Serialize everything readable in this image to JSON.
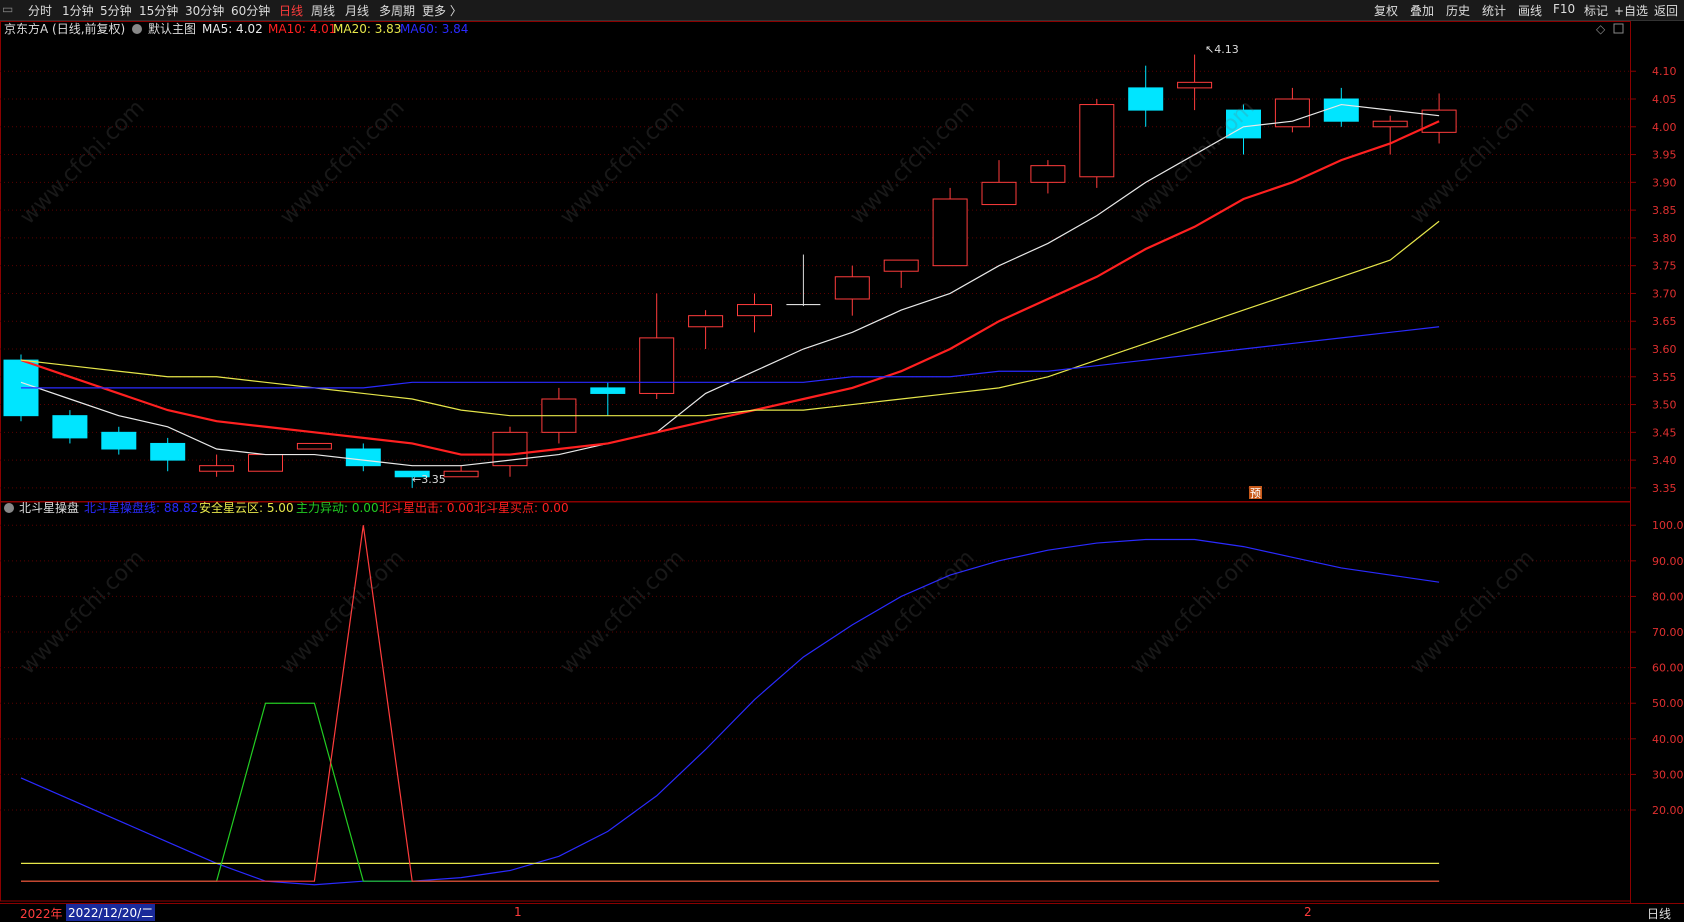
{
  "toolbar": {
    "left_items": [
      "分时",
      "1分钟",
      "5分钟",
      "15分钟",
      "30分钟",
      "60分钟",
      "日线",
      "周线",
      "月线",
      "多周期",
      "更多 〉"
    ],
    "active": "日线",
    "right_items": [
      "复权",
      "叠加",
      "历史",
      "统计",
      "画线",
      "F10",
      "标记",
      "+自选",
      "返回"
    ]
  },
  "main_header": {
    "stock": "京东方A (日线,前复权)",
    "template": "默认主图",
    "ma5": "MA5: 4.02",
    "ma10": "MA10: 4.01",
    "ma20": "MA20: 3.83",
    "ma60": "MA60: 3.84"
  },
  "indicator_header": {
    "name": "北斗星操盘",
    "line1": "北斗星操盘线: 88.82",
    "line2": "安全星云区: 5.00",
    "line3": "主力异动: 0.00",
    "line4": "北斗星出击: 0.00",
    "line5": "北斗星买点: 0.00"
  },
  "annotations": {
    "high": "4.13",
    "low": "3.35",
    "pre": "预"
  },
  "watermark": "www.cfchi.com",
  "bottom": {
    "year": "2022年",
    "cursor_date": "2022/12/20/二",
    "m1": "1",
    "m2": "2",
    "period": "日线"
  },
  "colors": {
    "up": "#ff3c3c",
    "down": "#00e5ff",
    "ma5": "#e8e8e8",
    "ma10": "#ff2020",
    "ma20": "#e6e64a",
    "ma60": "#2a2aff",
    "ind_green": "#22cc22",
    "ind_blue": "#2a2aff",
    "ind_yellow": "#e6e64a"
  },
  "chart_data": [
    {
      "type": "candlestick",
      "title": "京东方A (日线,前复权)",
      "ylim": [
        3.33,
        4.14
      ],
      "yticks": [
        "4.10",
        "4.05",
        "4.00",
        "3.95",
        "3.90",
        "3.85",
        "3.80",
        "3.75",
        "3.70",
        "3.65",
        "3.60",
        "3.55",
        "3.50",
        "3.45",
        "3.40",
        "3.35"
      ],
      "candles": [
        {
          "o": 3.58,
          "c": 3.48,
          "h": 3.59,
          "l": 3.47
        },
        {
          "o": 3.48,
          "c": 3.44,
          "h": 3.49,
          "l": 3.43
        },
        {
          "o": 3.45,
          "c": 3.42,
          "h": 3.46,
          "l": 3.41
        },
        {
          "o": 3.43,
          "c": 3.4,
          "h": 3.44,
          "l": 3.38
        },
        {
          "o": 3.38,
          "c": 3.39,
          "h": 3.41,
          "l": 3.37
        },
        {
          "o": 3.38,
          "c": 3.41,
          "h": 3.41,
          "l": 3.38
        },
        {
          "o": 3.42,
          "c": 3.43,
          "h": 3.43,
          "l": 3.42
        },
        {
          "o": 3.42,
          "c": 3.39,
          "h": 3.43,
          "l": 3.38
        },
        {
          "o": 3.38,
          "c": 3.37,
          "h": 3.38,
          "l": 3.35
        },
        {
          "o": 3.37,
          "c": 3.38,
          "h": 3.39,
          "l": 3.37
        },
        {
          "o": 3.39,
          "c": 3.45,
          "h": 3.46,
          "l": 3.37
        },
        {
          "o": 3.45,
          "c": 3.51,
          "h": 3.53,
          "l": 3.43
        },
        {
          "o": 3.53,
          "c": 3.52,
          "h": 3.54,
          "l": 3.48
        },
        {
          "o": 3.52,
          "c": 3.62,
          "h": 3.7,
          "l": 3.51
        },
        {
          "o": 3.64,
          "c": 3.66,
          "h": 3.67,
          "l": 3.6
        },
        {
          "o": 3.66,
          "c": 3.68,
          "h": 3.7,
          "l": 3.63
        },
        {
          "o": 3.68,
          "c": 3.68,
          "h": 3.77,
          "l": 3.68
        },
        {
          "o": 3.69,
          "c": 3.73,
          "h": 3.75,
          "l": 3.66
        },
        {
          "o": 3.74,
          "c": 3.76,
          "h": 3.76,
          "l": 3.71
        },
        {
          "o": 3.75,
          "c": 3.87,
          "h": 3.89,
          "l": 3.75
        },
        {
          "o": 3.86,
          "c": 3.9,
          "h": 3.94,
          "l": 3.86
        },
        {
          "o": 3.9,
          "c": 3.93,
          "h": 3.94,
          "l": 3.88
        },
        {
          "o": 3.91,
          "c": 4.04,
          "h": 4.05,
          "l": 3.89
        },
        {
          "o": 4.07,
          "c": 4.03,
          "h": 4.11,
          "l": 4.0
        },
        {
          "o": 4.07,
          "c": 4.08,
          "h": 4.13,
          "l": 4.03
        },
        {
          "o": 4.03,
          "c": 3.98,
          "h": 4.04,
          "l": 3.95
        },
        {
          "o": 4.0,
          "c": 4.05,
          "h": 4.07,
          "l": 3.99
        },
        {
          "o": 4.05,
          "c": 4.01,
          "h": 4.07,
          "l": 4.0
        },
        {
          "o": 4.0,
          "c": 4.01,
          "h": 4.02,
          "l": 3.95
        },
        {
          "o": 3.99,
          "c": 4.03,
          "h": 4.06,
          "l": 3.97
        }
      ],
      "series": [
        {
          "name": "MA5",
          "values": [
            3.54,
            3.51,
            3.48,
            3.46,
            3.42,
            3.41,
            3.41,
            3.4,
            3.39,
            3.39,
            3.4,
            3.41,
            3.43,
            3.45,
            3.52,
            3.56,
            3.6,
            3.63,
            3.67,
            3.7,
            3.75,
            3.79,
            3.84,
            3.9,
            3.95,
            4.0,
            4.01,
            4.04,
            4.03,
            4.02
          ]
        },
        {
          "name": "MA10",
          "values": [
            3.58,
            3.55,
            3.52,
            3.49,
            3.47,
            3.46,
            3.45,
            3.44,
            3.43,
            3.41,
            3.41,
            3.42,
            3.43,
            3.45,
            3.47,
            3.49,
            3.51,
            3.53,
            3.56,
            3.6,
            3.65,
            3.69,
            3.73,
            3.78,
            3.82,
            3.87,
            3.9,
            3.94,
            3.97,
            4.01
          ]
        },
        {
          "name": "MA20",
          "values": [
            3.58,
            3.57,
            3.56,
            3.55,
            3.55,
            3.54,
            3.53,
            3.52,
            3.51,
            3.49,
            3.48,
            3.48,
            3.48,
            3.48,
            3.48,
            3.49,
            3.49,
            3.5,
            3.51,
            3.52,
            3.53,
            3.55,
            3.58,
            3.61,
            3.64,
            3.67,
            3.7,
            3.73,
            3.76,
            3.83
          ]
        },
        {
          "name": "MA60",
          "values": [
            3.53,
            3.53,
            3.53,
            3.53,
            3.53,
            3.53,
            3.53,
            3.53,
            3.54,
            3.54,
            3.54,
            3.54,
            3.54,
            3.54,
            3.54,
            3.54,
            3.54,
            3.55,
            3.55,
            3.55,
            3.56,
            3.56,
            3.57,
            3.58,
            3.59,
            3.6,
            3.61,
            3.62,
            3.63,
            3.64
          ]
        }
      ]
    },
    {
      "type": "line",
      "title": "北斗星操盘",
      "ylim": [
        -5,
        104
      ],
      "yticks": [
        "100.0",
        "90.00",
        "80.00",
        "70.00",
        "60.00",
        "50.00",
        "40.00",
        "30.00",
        "20.00"
      ],
      "series": [
        {
          "name": "北斗星操盘线",
          "values": [
            29,
            23,
            17,
            11,
            5,
            0,
            -1,
            0,
            0,
            1,
            3,
            7,
            14,
            24,
            37,
            51,
            63,
            72,
            80,
            86,
            90,
            93,
            95,
            96,
            96,
            94,
            91,
            88,
            86,
            84
          ]
        },
        {
          "name": "安全星云区",
          "values": [
            5,
            5,
            5,
            5,
            5,
            5,
            5,
            5,
            5,
            5,
            5,
            5,
            5,
            5,
            5,
            5,
            5,
            5,
            5,
            5,
            5,
            5,
            5,
            5,
            5,
            5,
            5,
            5,
            5,
            5
          ]
        },
        {
          "name": "主力异动",
          "values": [
            0,
            0,
            0,
            0,
            0,
            50,
            50,
            0,
            0,
            0,
            0,
            0,
            0,
            0,
            0,
            0,
            0,
            0,
            0,
            0,
            0,
            0,
            0,
            0,
            0,
            0,
            0,
            0,
            0,
            0
          ]
        },
        {
          "name": "北斗星出击",
          "values": [
            0,
            0,
            0,
            0,
            0,
            0,
            0,
            100,
            0,
            0,
            0,
            0,
            0,
            0,
            0,
            0,
            0,
            0,
            0,
            0,
            0,
            0,
            0,
            0,
            0,
            0,
            0,
            0,
            0,
            0
          ]
        }
      ]
    }
  ]
}
